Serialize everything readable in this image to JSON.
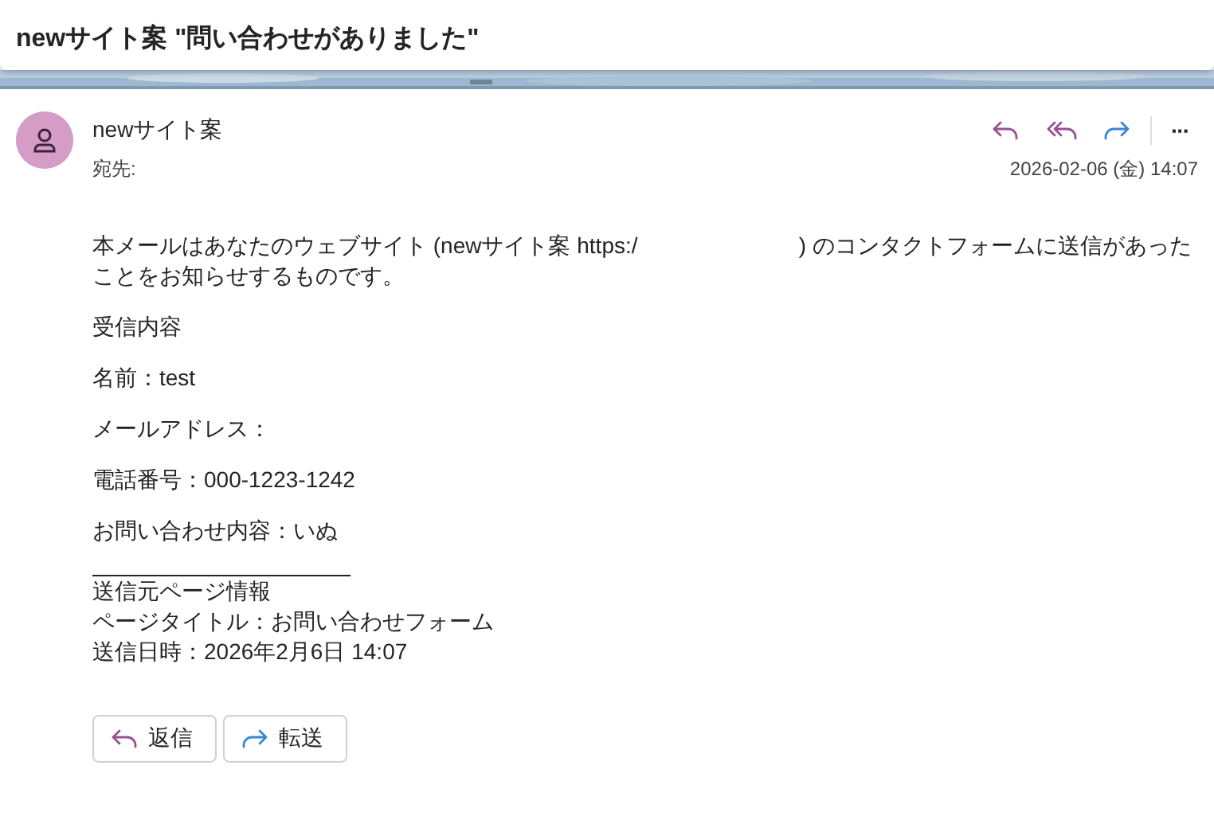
{
  "subject": "newサイト案 \"問い合わせがありました\"",
  "message": {
    "sender": "newサイト案",
    "to_label": "宛先:",
    "date": "2026-02-06 (金) 14:07",
    "actions": [
      {
        "kind": "reply"
      },
      {
        "kind": "reply-all"
      },
      {
        "kind": "forward"
      },
      {
        "kind": "more",
        "label": "···"
      }
    ],
    "body": [
      {
        "kind": "paragraph",
        "text": "本メールはあなたのウェブサイト (newサイト案 https:/                          ) のコンタクトフォームに送信があったことをお知らせするものです。"
      },
      {
        "kind": "paragraph",
        "text": "受信内容"
      },
      {
        "kind": "paragraph",
        "text": "名前：test"
      },
      {
        "kind": "paragraph",
        "text": "メールアドレス："
      },
      {
        "kind": "paragraph",
        "text": "電話番号：000-1223-1242"
      },
      {
        "kind": "paragraph",
        "text": "お問い合わせ内容：いぬ"
      },
      {
        "kind": "rule"
      },
      {
        "kind": "lines",
        "lines": [
          "送信元ページ情報",
          "ページタイトル：お問い合わせフォーム",
          "送信日時：2026年2月6日 14:07"
        ]
      }
    ],
    "buttons": [
      {
        "kind": "reply",
        "label": "返信"
      },
      {
        "kind": "forward",
        "label": "転送"
      }
    ]
  }
}
